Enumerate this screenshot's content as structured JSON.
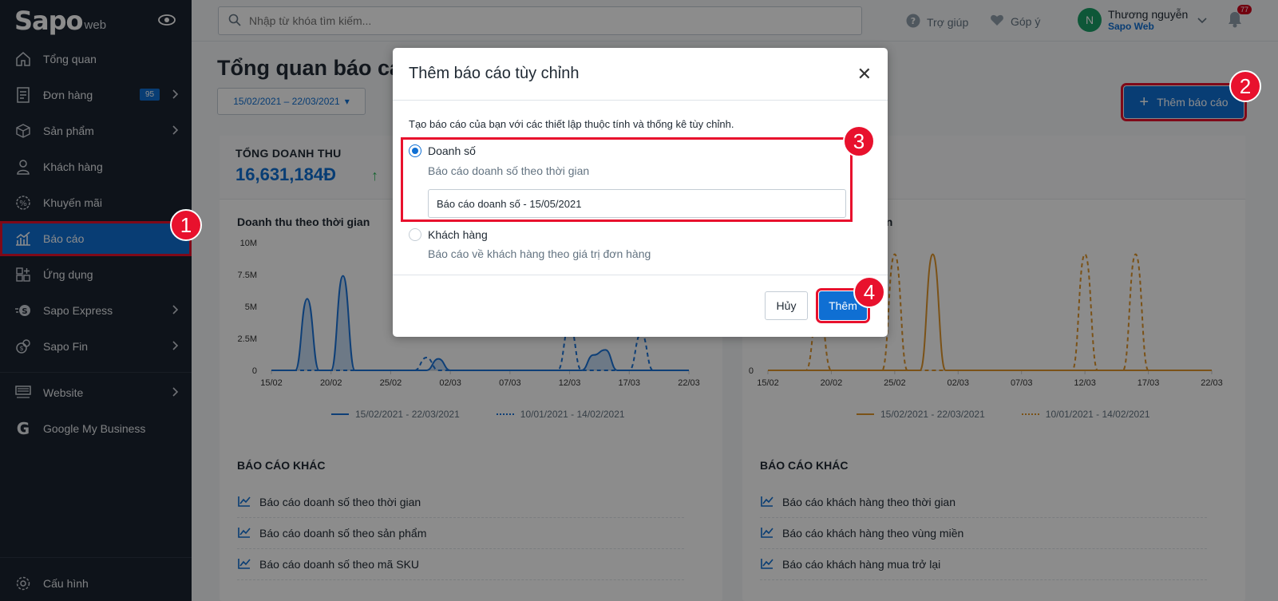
{
  "app": {
    "logo": "Sapo",
    "logo_sub": "web"
  },
  "sidebar": {
    "items": [
      {
        "label": "Tổng quan",
        "icon": "home-icon"
      },
      {
        "label": "Đơn hàng",
        "icon": "order-icon",
        "badge": "95"
      },
      {
        "label": "Sản phẩm",
        "icon": "box-icon"
      },
      {
        "label": "Khách hàng",
        "icon": "user-icon"
      },
      {
        "label": "Khuyến mãi",
        "icon": "discount-icon"
      },
      {
        "label": "Báo cáo",
        "icon": "chart-icon",
        "active": true
      },
      {
        "label": "Ứng dụng",
        "icon": "apps-icon"
      },
      {
        "label": "Sapo Express",
        "icon": "express-icon"
      },
      {
        "label": "Sapo Fin",
        "icon": "fin-icon"
      },
      {
        "label": "Website",
        "icon": "website-icon"
      },
      {
        "label": "Google My Business",
        "icon": "google-icon"
      }
    ],
    "settings": "Cấu hình"
  },
  "topbar": {
    "search_placeholder": "Nhập từ khóa tìm kiếm...",
    "help": "Trợ giúp",
    "feedback": "Góp ý",
    "user_initial": "N",
    "user_name": "Thương nguyễn",
    "user_store": "Sapo Web",
    "notifications": "77"
  },
  "main": {
    "title": "Tổng quan báo cáo",
    "date_range": "15/02/2021 – 22/03/2021",
    "add_report": "Thêm báo cáo",
    "left_card": {
      "kpi_label": "TỔNG DOANH THU",
      "kpi_value": "16,631,184Đ",
      "chart_title": "Doanh thu theo thời gian",
      "other_title": "BÁO CÁO KHÁC",
      "others": [
        "Báo cáo doanh số theo thời gian",
        "Báo cáo doanh số theo sản phẩm",
        "Báo cáo doanh số theo mã SKU"
      ]
    },
    "right_card": {
      "chart_title_tail": "an",
      "other_title": "BÁO CÁO KHÁC",
      "others": [
        "Báo cáo khách hàng theo thời gian",
        "Báo cáo khách hàng theo vùng miền",
        "Báo cáo khách hàng mua trở lại"
      ]
    },
    "legend": {
      "current": "15/02/2021 - 22/03/2021",
      "previous": "10/01/2021 - 14/02/2021"
    }
  },
  "chart_data": [
    {
      "type": "line",
      "x": [
        "15/02",
        "20/02",
        "25/02",
        "02/03",
        "07/03",
        "12/03",
        "17/03",
        "22/03"
      ],
      "yticks": [
        "10M",
        "7.5M",
        "5M",
        "2.5M",
        "0"
      ],
      "ylim": [
        0,
        10000000
      ],
      "color": "#1a73d9",
      "series": [
        {
          "name": "15/02/2021 - 22/03/2021",
          "style": "solid",
          "values": [
            0,
            0,
            0,
            5600000,
            0,
            0,
            7400000,
            0,
            0,
            0,
            0,
            0,
            0.5,
            0,
            900000,
            0,
            0,
            0,
            0,
            0,
            0,
            0,
            0,
            0,
            0,
            0,
            0,
            1200000,
            1600000,
            0,
            0,
            0,
            0,
            0,
            0,
            0
          ]
        },
        {
          "name": "10/01/2021 - 14/02/2021",
          "style": "dashed",
          "values": [
            0,
            0,
            0,
            0,
            0,
            0,
            0,
            0,
            0,
            0,
            0,
            0,
            0,
            1000000,
            0,
            0,
            0,
            0,
            0,
            0,
            0,
            0,
            0,
            0,
            0,
            3500000,
            0,
            0,
            0,
            0,
            0,
            2900000,
            0,
            0,
            0,
            0
          ]
        }
      ]
    },
    {
      "type": "line",
      "x": [
        "15/02",
        "20/02",
        "25/02",
        "02/03",
        "07/03",
        "12/03",
        "17/03",
        "22/03"
      ],
      "color": "#e0952b",
      "series": [
        {
          "name": "15/02/2021 - 22/03/2021",
          "style": "solid",
          "values": [
            0,
            0,
            0,
            0,
            0,
            0,
            0,
            0,
            0,
            0,
            0,
            0,
            0,
            1,
            0,
            0,
            0,
            0,
            0,
            0,
            0,
            0,
            0,
            0,
            0,
            0,
            0,
            0,
            0,
            0,
            0,
            0,
            0,
            0,
            0,
            0
          ]
        },
        {
          "name": "10/01/2021 - 14/02/2021",
          "style": "dashed",
          "values": [
            0,
            0,
            0,
            0,
            0.55,
            0,
            0,
            0,
            0,
            0,
            1,
            0,
            0,
            0,
            0,
            0,
            0,
            0,
            0,
            0,
            0,
            0,
            0,
            0,
            0,
            1,
            0,
            0,
            0,
            1,
            0,
            0,
            0,
            0,
            0,
            0
          ]
        }
      ]
    }
  ],
  "modal": {
    "title": "Thêm báo cáo tùy chỉnh",
    "description": "Tạo báo cáo của bạn với các thiết lập thuộc tính và thống kê tùy chỉnh.",
    "option1_label": "Doanh số",
    "option1_desc": "Báo cáo doanh số theo thời gian",
    "report_name": "Báo cáo doanh số - 15/05/2021",
    "option2_label": "Khách hàng",
    "option2_desc": "Báo cáo về khách hàng theo giá trị đơn hàng",
    "cancel": "Hủy",
    "add": "Thêm"
  },
  "steps": [
    "1",
    "2",
    "3",
    "4"
  ]
}
